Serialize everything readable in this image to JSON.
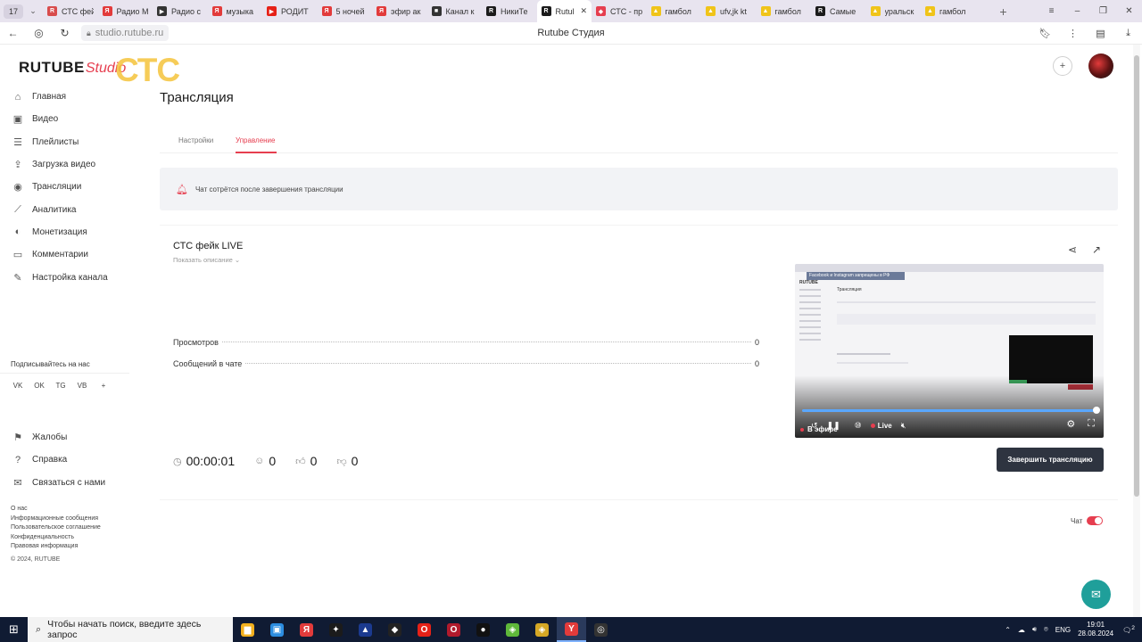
{
  "browser": {
    "tab_counter": "17",
    "tabs": [
      {
        "title": "СТС фей",
        "color": "#d84c4c",
        "glyph": "R"
      },
      {
        "title": "Радио М",
        "color": "#e23b3b",
        "glyph": "Я"
      },
      {
        "title": "Радио с",
        "color": "#333333",
        "glyph": "▶"
      },
      {
        "title": "музыка",
        "color": "#e23b3b",
        "glyph": "Я"
      },
      {
        "title": "РОДИТ",
        "color": "#e62117",
        "glyph": "▶"
      },
      {
        "title": "5 ночей",
        "color": "#e23b3b",
        "glyph": "Я"
      },
      {
        "title": "эфир ак",
        "color": "#e23b3b",
        "glyph": "Я"
      },
      {
        "title": "Канал к",
        "color": "#333333",
        "glyph": "■"
      },
      {
        "title": "НикиТе",
        "color": "#1b1b1b",
        "glyph": "R"
      },
      {
        "title": "Rutul",
        "color": "#1b1b1b",
        "glyph": "R",
        "active": true
      },
      {
        "title": "СТС - пр",
        "color": "#e63e4f",
        "glyph": "◆"
      },
      {
        "title": "гамбол",
        "color": "#f0c419",
        "glyph": "▲"
      },
      {
        "title": "ufv,jk kt",
        "color": "#f0c419",
        "glyph": "▲"
      },
      {
        "title": "гамбол",
        "color": "#f0c419",
        "glyph": "▲"
      },
      {
        "title": "Самые",
        "color": "#1b1b1b",
        "glyph": "R"
      },
      {
        "title": "уральск",
        "color": "#f0c419",
        "glyph": "▲"
      },
      {
        "title": "гамбол",
        "color": "#f0c419",
        "glyph": "▲"
      }
    ],
    "url": "studio.rutube.ru",
    "page_title": "Rutube Студия"
  },
  "logo": {
    "main": "RUTUBE",
    "studio": "Studio",
    "overlay": "СТС"
  },
  "sidebar": {
    "items": [
      {
        "label": "Главная",
        "icon": "⌂"
      },
      {
        "label": "Видео",
        "icon": "▣"
      },
      {
        "label": "Плейлисты",
        "icon": "☰"
      },
      {
        "label": "Загрузка видео",
        "icon": "⇪"
      },
      {
        "label": "Трансляции",
        "icon": "◉"
      },
      {
        "label": "Аналитика",
        "icon": "⟋"
      },
      {
        "label": "Монетизация",
        "icon": "◐"
      },
      {
        "label": "Комментарии",
        "icon": "▭"
      },
      {
        "label": "Настройка канала",
        "icon": "✎"
      }
    ],
    "follow_label": "Подписывайтесь на нас",
    "socials": [
      "VK",
      "OK",
      "TG",
      "VB",
      "+"
    ],
    "items2": [
      {
        "label": "Жалобы",
        "icon": "⚑"
      },
      {
        "label": "Справка",
        "icon": "?"
      },
      {
        "label": "Связаться с нами",
        "icon": "✉"
      }
    ],
    "footer_links": [
      "О нас",
      "Информационные сообщения",
      "Пользовательское соглашение",
      "Конфиденциальность",
      "Правовая информация"
    ],
    "copyright": "© 2024, RUTUBE"
  },
  "page": {
    "title": "Трансляция",
    "tabs": {
      "settings": "Настройки",
      "manage": "Управление"
    },
    "alert": "Чат сотрётся после завершения трансляции"
  },
  "stream": {
    "title": "СТС фейк LIVE",
    "show_description": "Показать описание ⌄",
    "stats": [
      {
        "label": "Просмотров",
        "value": "0"
      },
      {
        "label": "Сообщений в чате",
        "value": "0"
      }
    ],
    "duration": "00:00:01",
    "viewers": "0",
    "likes": "0",
    "dislikes": "0",
    "end_button": "Завершить трансляцию",
    "preview": {
      "banner": "Facebook и Instagram запрещены в РФ",
      "mini_title": "Трансляция",
      "on_air": "В эфире",
      "live": "Live"
    }
  },
  "chat": {
    "label": "Чат",
    "enabled": true
  },
  "taskbar": {
    "search_placeholder": "Чтобы начать поиск, введите здесь запрос",
    "apps": [
      {
        "name": "explorer",
        "color": "#f2b01e",
        "glyph": "▆"
      },
      {
        "name": "store",
        "color": "#2c8de0",
        "glyph": "▣"
      },
      {
        "name": "yandex",
        "color": "#e23b3b",
        "glyph": "Я"
      },
      {
        "name": "app-yellow",
        "color": "#1b1b1b",
        "glyph": "✦"
      },
      {
        "name": "app-blue",
        "color": "#1b3a8f",
        "glyph": "▲"
      },
      {
        "name": "app-dark",
        "color": "#222222",
        "glyph": "◆"
      },
      {
        "name": "opera",
        "color": "#e62117",
        "glyph": "O"
      },
      {
        "name": "opera-gx",
        "color": "#b11a2c",
        "glyph": "O"
      },
      {
        "name": "record",
        "color": "#111111",
        "glyph": "●"
      },
      {
        "name": "bluestacks",
        "color": "#5fb83a",
        "glyph": "◈"
      },
      {
        "name": "bluestacks2",
        "color": "#d6a825",
        "glyph": "◈"
      },
      {
        "name": "yandex-browser",
        "color": "#e23b3b",
        "glyph": "Y",
        "active": true
      },
      {
        "name": "obs",
        "color": "#333333",
        "glyph": "◎"
      }
    ],
    "lang": "ENG",
    "time": "19:01",
    "date": "28.08.2024",
    "notifications": "2"
  }
}
